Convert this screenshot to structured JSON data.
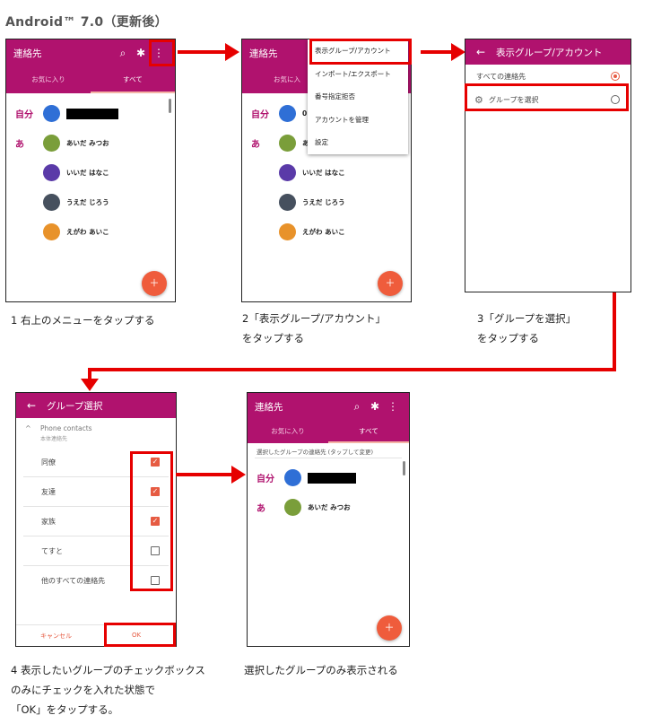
{
  "page_title": "Android™ 7.0（更新後）",
  "colors": {
    "appbar": "#b0126e",
    "accent": "#ef5c3c",
    "highlight": "#e60000"
  },
  "screen1": {
    "app_title": "連絡先",
    "icons": [
      "search-icon",
      "asterisk-icon",
      "more-vert-icon"
    ],
    "tabs": [
      "お気に入り",
      "すべて"
    ],
    "active_tab": "すべて",
    "self_label": "自分",
    "section_letter": "あ",
    "contacts": [
      "あいだ みつお",
      "いいだ はなこ",
      "うえだ じろう",
      "えがわ あいこ"
    ]
  },
  "screen2": {
    "app_title": "連絡先",
    "tab_partial": "お気に入",
    "self_label": "自分",
    "self_partial": "0",
    "section_letter": "あ",
    "contacts": [
      "あ",
      "いいだ はなこ",
      "うえだ じろう",
      "えがわ あいこ"
    ],
    "menu": [
      "表示グループ/アカウント",
      "インポート/エクスポート",
      "番号指定拒否",
      "アカウントを管理",
      "設定"
    ]
  },
  "screen3": {
    "title": "表示グループ/アカウント",
    "options": [
      "すべての連絡先",
      "グループを選択"
    ],
    "selected": "すべての連絡先"
  },
  "screen4": {
    "title": "グループ選択",
    "section": "Phone contacts",
    "section_sub": "本体連絡先",
    "groups": [
      {
        "label": "同僚",
        "checked": true
      },
      {
        "label": "友達",
        "checked": true
      },
      {
        "label": "家族",
        "checked": true
      },
      {
        "label": "てすと",
        "checked": false
      },
      {
        "label": "他のすべての連絡先",
        "checked": false
      }
    ],
    "cancel": "キャンセル",
    "ok": "OK"
  },
  "screen5": {
    "app_title": "連絡先",
    "tabs": [
      "お気に入り",
      "すべて"
    ],
    "filter_note": "選択したグループの連絡先 (タップして変更)",
    "self_label": "自分",
    "section_letter": "あ",
    "contacts": [
      "あいだ みつお"
    ]
  },
  "captions": {
    "step1": [
      "1  右上のメニューをタップする"
    ],
    "step2": [
      "2「表示グループ/アカウント」",
      "   をタップする"
    ],
    "step3": [
      "3「グループを選択」",
      "   をタップする"
    ],
    "step4": [
      "4  表示したいグループのチェックボックス",
      "   のみにチェックを入れた状態で",
      "  「OK」をタップする。"
    ],
    "step5": [
      "選択したグループのみ表示される"
    ]
  }
}
